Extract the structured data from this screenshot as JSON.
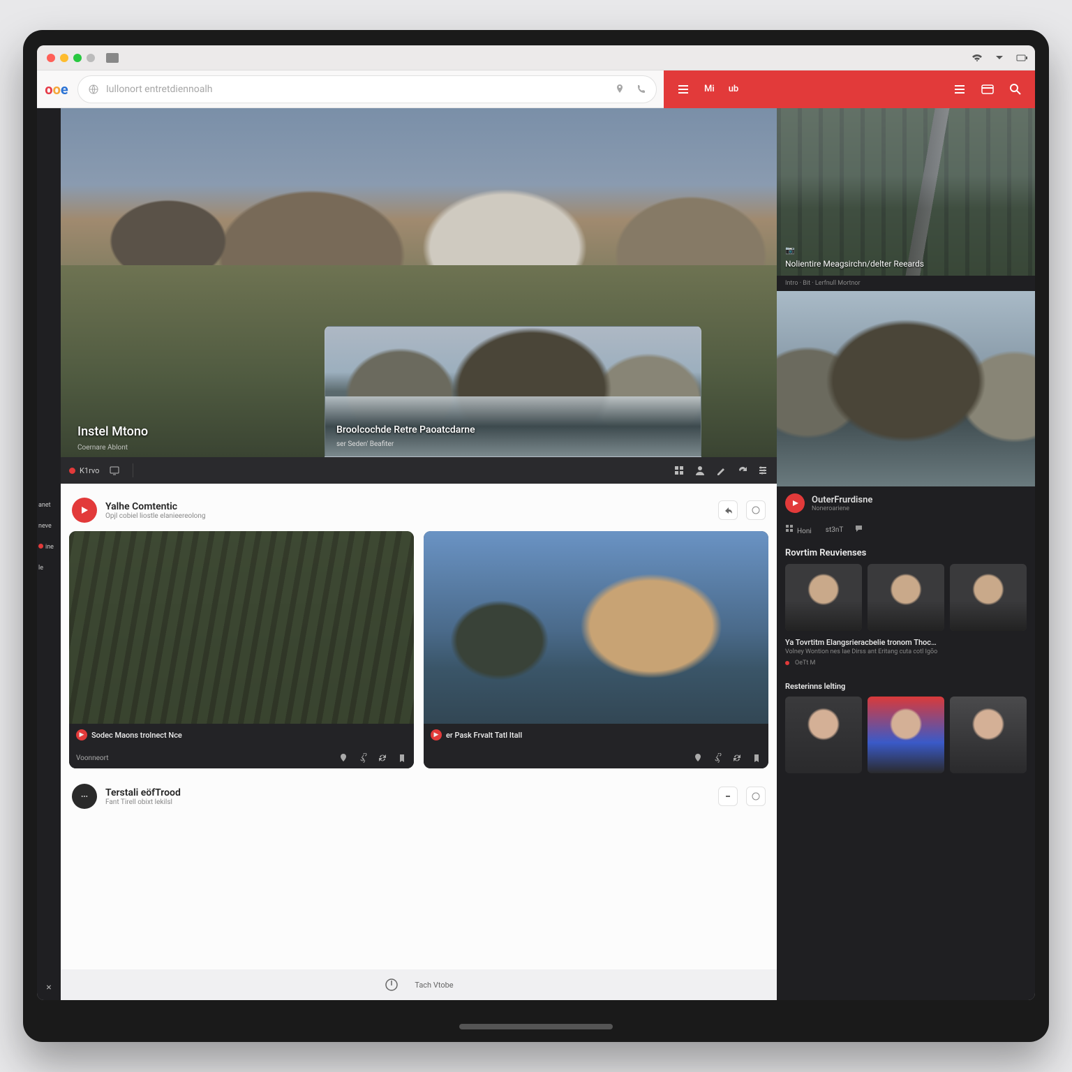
{
  "accent": "#e23a3a",
  "window": {
    "sys_labels": [
      "wifi-icon",
      "dropdown-icon",
      "battery-icon"
    ]
  },
  "address": {
    "logo_chars": [
      "o",
      "o",
      "e"
    ],
    "url_placeholder": "Iullonort entretdiennoalh",
    "right_icons": [
      "pin-icon",
      "phone-icon"
    ]
  },
  "redbar": {
    "left": [
      "menu-icon",
      "Mi",
      "ub"
    ],
    "right": [
      "menu2-icon",
      "card-icon",
      "search-icon"
    ]
  },
  "sidebar": {
    "items": [
      "anet",
      "neve",
      "ine",
      "le"
    ],
    "dotted_index": 2
  },
  "hero": {
    "label": "Instel Mtono",
    "sublabel": "Coernare Ablont",
    "card_title": "Broolcochde Retre Paoatcdarne",
    "card_sub": "ser Seden' Beafiter"
  },
  "hero_toolbar": {
    "left_items": [
      {
        "icon": "record",
        "label": "K1rvo"
      },
      {
        "icon": "tv",
        "label": ""
      }
    ],
    "right_icons": [
      "grid-icon",
      "person-icon",
      "edit-icon",
      "redo-icon",
      "levels-icon"
    ]
  },
  "feed": {
    "post1": {
      "avatar_text": "",
      "title": "Yalhe Comtentic",
      "subtitle": "Opjl cobiel liostle elanieereolong",
      "actions": [
        "share-icon",
        "more-icon"
      ]
    },
    "cards": [
      {
        "kind": "bike",
        "title": "Sodec Maons trolnect Nce",
        "footer_label": "Voonneort",
        "footer_icons": [
          "pin-icon",
          "share-icon",
          "loop-icon",
          "bookmark-icon"
        ]
      },
      {
        "kind": "lake",
        "title": "er Pask Frvalt Tatl Itall",
        "footer_label": "",
        "footer_icons": [
          "pin-icon",
          "share-icon",
          "loop-icon",
          "bookmark-icon"
        ]
      }
    ],
    "post2": {
      "avatar_text": "",
      "title": "Terstali eöfTrood",
      "subtitle": "Fant Tirell obixt lekilsl",
      "actions": [
        "collapse-icon",
        "more-icon"
      ]
    }
  },
  "right": {
    "thumb1": {
      "icon_text": "",
      "title": "Nolientire Meagsirchn/delter Reeards"
    },
    "mini_meta": "Intro · Bit · Lerfnull Mortnor",
    "channel": {
      "name": "OuterFrurdisne",
      "sub": "Noneroariene"
    },
    "tabs": [
      {
        "icon": "grid",
        "label": "Honi"
      },
      {
        "icon": "record",
        "label": "st3nT"
      },
      {
        "icon": "comment",
        "label": ""
      }
    ],
    "section1": "Rovrtim Reuvienses",
    "review": {
      "title": "Ya Tovrtitm Elangsrieracbelie tronom Thoc…",
      "sub": "Volney Wontion nes Iae Dirss ant Eritang cuta cotl Igõo",
      "meta": "OeTt M"
    },
    "section2": "Resterinns lelting"
  },
  "dock": {
    "label": "Tach Vtobe"
  }
}
